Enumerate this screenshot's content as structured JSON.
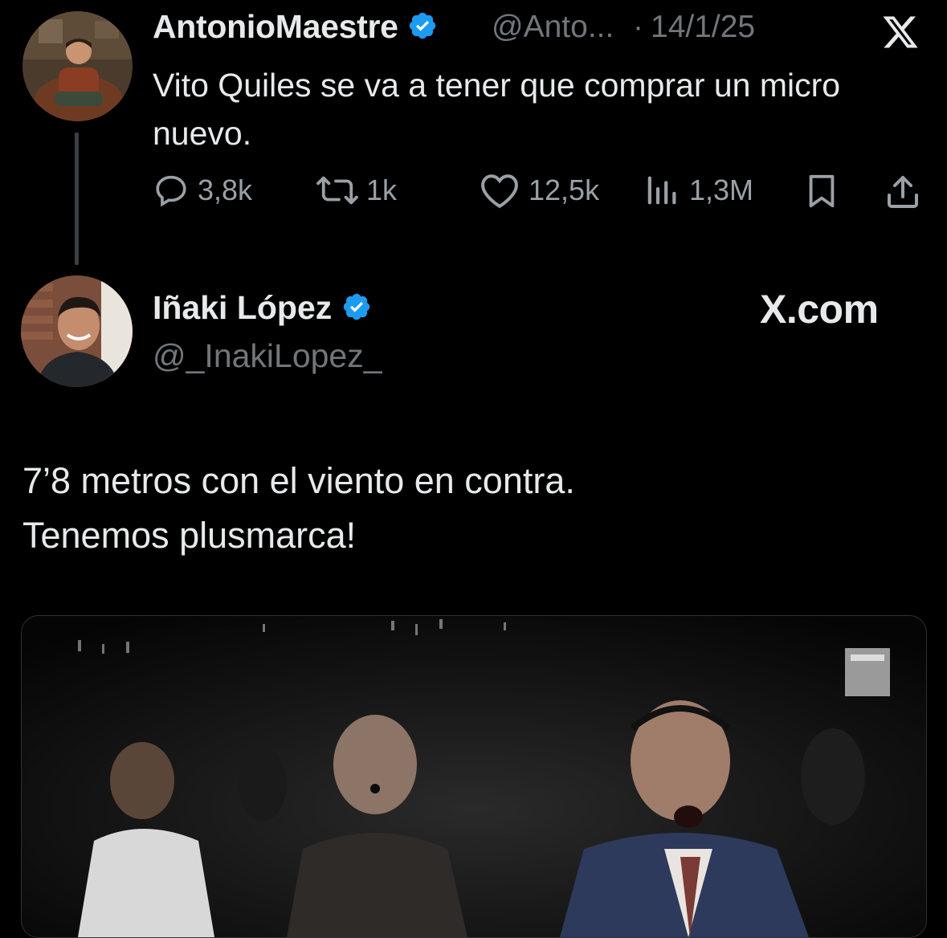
{
  "quoted_tweet": {
    "display_name": "AntonioMaestre",
    "handle": "@Anto...",
    "separator": "·",
    "date": "14/1/25",
    "text": "Vito Quiles se va a tener que comprar un micro nuevo.",
    "actions": {
      "replies": "3,8k",
      "reposts": "1k",
      "likes": "12,5k",
      "views": "1,3M"
    },
    "icons": [
      "verified-badge-icon",
      "x-logo-icon",
      "reply-icon",
      "repost-icon",
      "like-icon",
      "views-icon",
      "bookmark-icon",
      "share-icon"
    ]
  },
  "main_tweet": {
    "display_name": "Iñaki López",
    "handle": "@_InakiLopez_",
    "brand": "X.com",
    "text_line1": "7’8 metros con el viento en contra.",
    "text_line2": "Tenemos plusmarca!"
  },
  "colors": {
    "background": "#000000",
    "text": "#e7e9ea",
    "muted": "#71767b",
    "verified": "#1d9bf0"
  }
}
